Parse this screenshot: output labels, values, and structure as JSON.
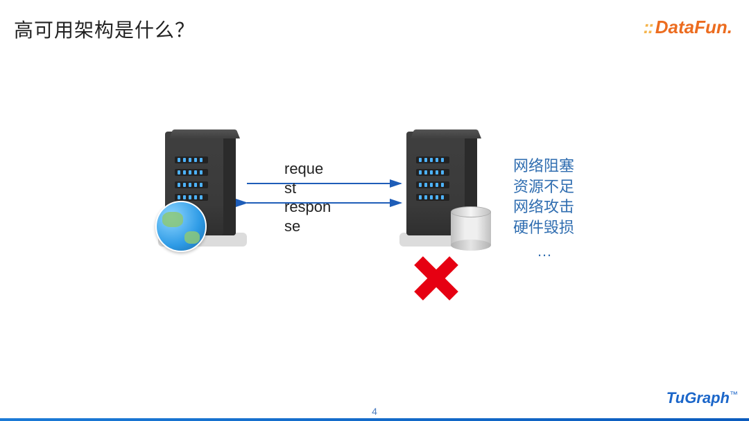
{
  "title": "高可用架构是什么？",
  "brand_top": "DataFun.",
  "brand_bottom": "TuGraph",
  "page_number": "4",
  "labels": {
    "request": "reque\nst",
    "response": "respon\nse"
  },
  "issues": {
    "item1": "网络阻塞",
    "item2": "资源不足",
    "item3": "网络攻击",
    "item4": "硬件毁损",
    "ellipsis": "…"
  },
  "icons": {
    "server_left": "web-server",
    "server_right": "db-server",
    "cross": "failure-cross",
    "globe": "globe-icon",
    "cylinder": "db-cylinder"
  }
}
